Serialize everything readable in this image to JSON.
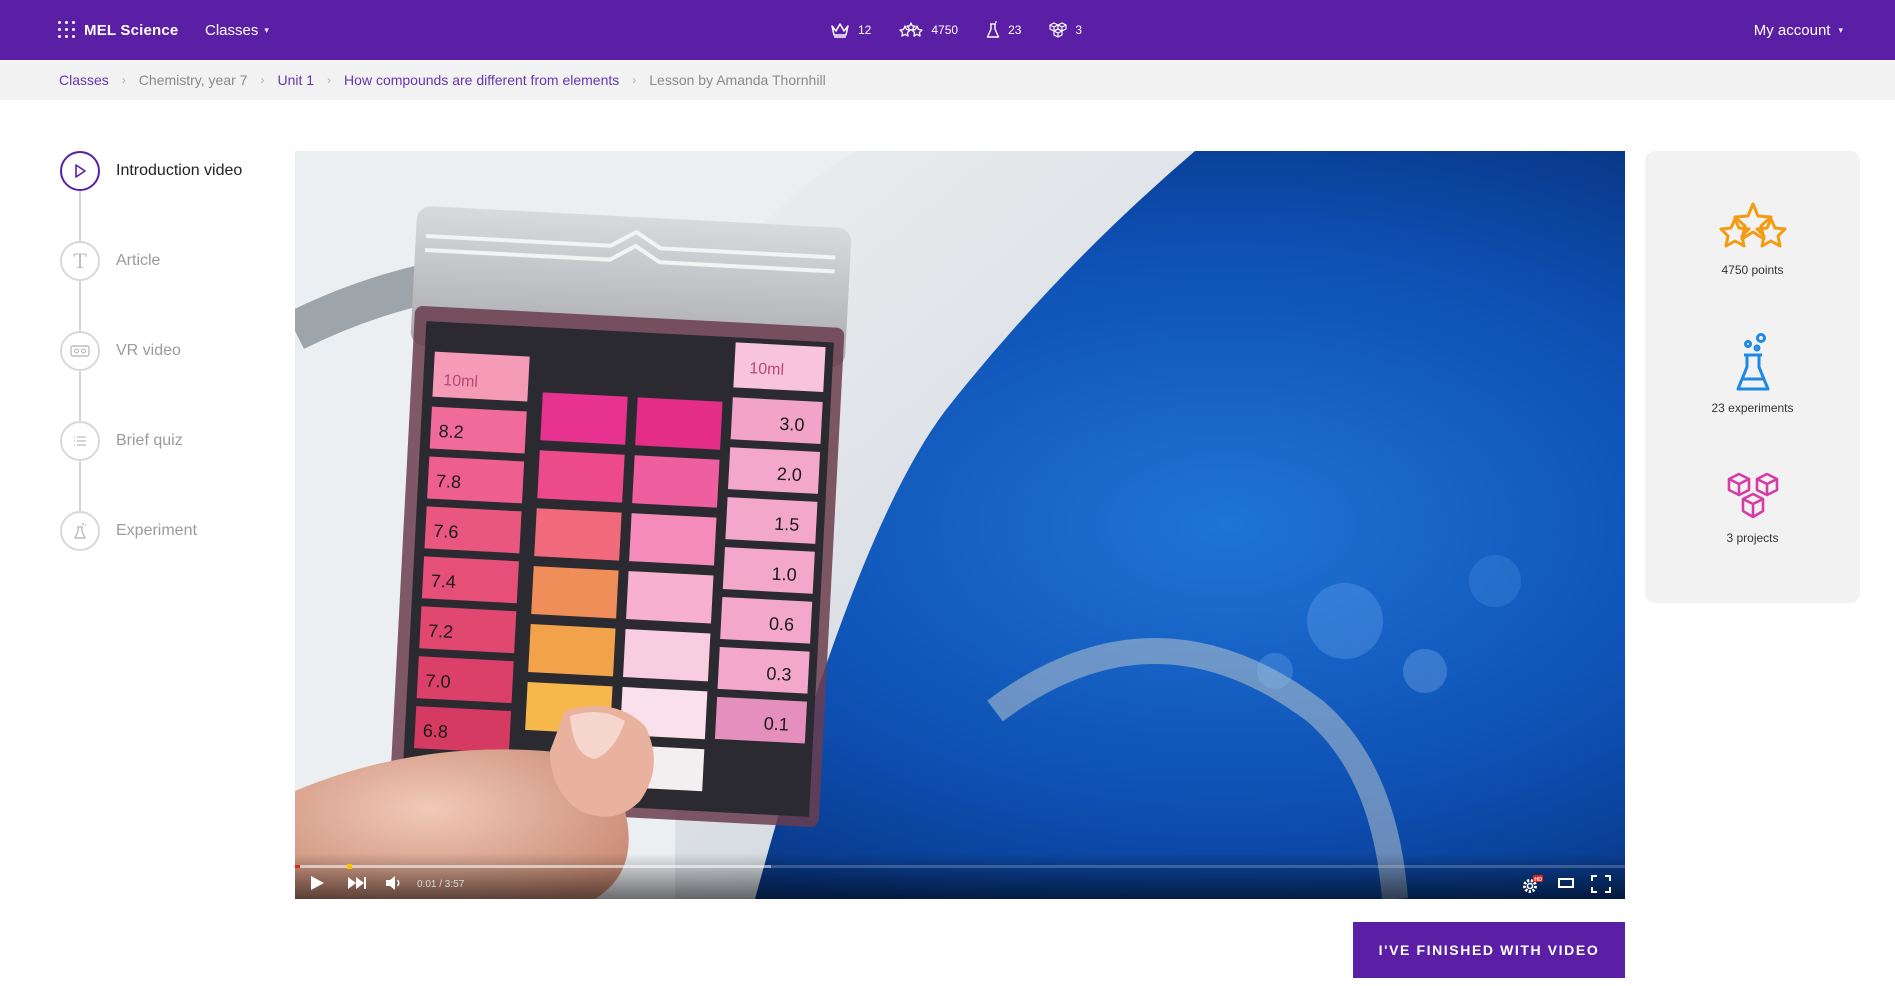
{
  "header": {
    "logo_text": "MEL Science",
    "classes_label": "Classes",
    "stats": [
      {
        "icon": "crown-icon",
        "value": "12"
      },
      {
        "icon": "stars-icon",
        "value": "4750"
      },
      {
        "icon": "flask-icon",
        "value": "23"
      },
      {
        "icon": "cubes-icon",
        "value": "3"
      }
    ],
    "account_label": "My account"
  },
  "breadcrumb": [
    {
      "label": "Classes",
      "link": true
    },
    {
      "label": "Chemistry, year 7",
      "link": false
    },
    {
      "label": "Unit 1",
      "link": true
    },
    {
      "label": "How compounds are different from elements",
      "link": true
    },
    {
      "label": "Lesson by Amanda Thornhill",
      "link": false
    }
  ],
  "steps": [
    {
      "label": "Introduction video",
      "icon": "play-icon",
      "active": true
    },
    {
      "label": "Article",
      "icon": "text-icon",
      "active": false
    },
    {
      "label": "VR video",
      "icon": "vr-headset-icon",
      "active": false
    },
    {
      "label": "Brief quiz",
      "icon": "list-icon",
      "active": false
    },
    {
      "label": "Experiment",
      "icon": "flask-icon",
      "active": false
    }
  ],
  "video": {
    "time_display": "0:01 / 3:57",
    "played_fraction": 0.004,
    "buffered_fraction": 0.358,
    "scale_left": [
      "10ml",
      "8.2",
      "7.8",
      "7.6",
      "7.4",
      "7.2",
      "7.0",
      "6.8"
    ],
    "scale_right": [
      "10ml",
      "3.0",
      "2.0",
      "1.5",
      "1.0",
      "0.6",
      "0.3",
      "0.1"
    ],
    "hd_badge": "HD"
  },
  "summary": [
    {
      "icon": "stars-icon",
      "label": "4750 points",
      "color": "#f39c12"
    },
    {
      "icon": "flask-icon",
      "label": "23 experiments",
      "color": "#1e88e5"
    },
    {
      "icon": "cubes-icon",
      "label": "3 projects",
      "color": "#d63ca8"
    }
  ],
  "finish_button": "I'VE FINISHED WITH VIDEO",
  "colors": {
    "brand": "#5b1fa6",
    "breadcrumb_link": "#6a35b0"
  }
}
